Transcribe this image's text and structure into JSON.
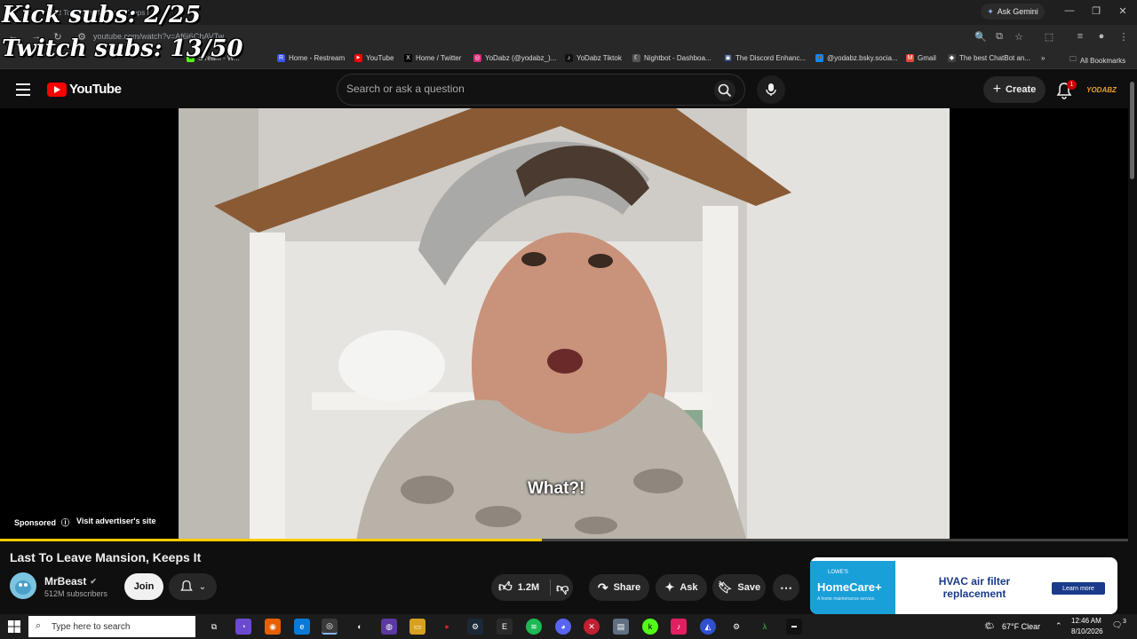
{
  "overlay": {
    "kick_subs": "Kick subs: 2/25",
    "twitch_subs": "Twitch subs: 13/50"
  },
  "browser": {
    "tab_title": "Last To Leave Mansion, Keeps It",
    "ask_gemini": "Ask Gemini",
    "url": "youtube.com/watch?v=Af6i6ChAVTw",
    "bookmarks": [
      {
        "label": "Stream - W...",
        "icon": "k",
        "color": "#53fc18"
      },
      {
        "label": "Home - Restream",
        "icon": "R",
        "color": "#3a53f2"
      },
      {
        "label": "YouTube",
        "icon": "▶",
        "color": "#ff0000"
      },
      {
        "label": "Home / Twitter",
        "icon": "X",
        "color": "#000000"
      },
      {
        "label": "YoDabz (@yodabz_)...",
        "icon": "◎",
        "color": "#d62976"
      },
      {
        "label": "YoDabz Tiktok",
        "icon": "♪",
        "color": "#111111"
      },
      {
        "label": "Nightbot - Dashboa...",
        "icon": "☾",
        "color": "#555555"
      },
      {
        "label": "The Discord Enhanc...",
        "icon": "▣",
        "color": "#223355"
      },
      {
        "label": "@yodabz.bsky.socia...",
        "icon": "🦋",
        "color": "#1185fe"
      },
      {
        "label": "Gmail",
        "icon": "M",
        "color": "#ea4335"
      },
      {
        "label": "The best ChatBot an...",
        "icon": "◆",
        "color": "#444444"
      }
    ],
    "all_bookmarks": "All Bookmarks"
  },
  "youtube": {
    "logo_text": "YouTube",
    "search_placeholder": "Search or ask a question",
    "create_label": "Create",
    "notif_count": "1",
    "account_label": "YODABZ",
    "player": {
      "caption": "What?!",
      "sponsored_label": "Sponsored",
      "visit_label": "Visit advertiser's site",
      "progress_fraction": 0.48
    },
    "video": {
      "title": "Last To Leave Mansion, Keeps It",
      "channel": "MrBeast",
      "subscribers": "512M subscribers",
      "join_label": "Join",
      "likes": "1.2M",
      "share_label": "Share",
      "ask_label": "Ask",
      "save_label": "Save"
    },
    "ad": {
      "logo": "LOWE'S",
      "brand": "HomeCare+",
      "tagline": "A home maintenance service.",
      "headline": "HVAC air filter replacement",
      "cta": "Learn more"
    }
  },
  "taskbar": {
    "search_placeholder": "Type here to search",
    "weather": "67°F  Clear",
    "time": "12:46 AM",
    "date": "8/10/2026",
    "notif_count": "3"
  },
  "colors": {
    "yt_red": "#ff0000",
    "progress": "#ffcc00",
    "background": "#0f0f0f"
  }
}
